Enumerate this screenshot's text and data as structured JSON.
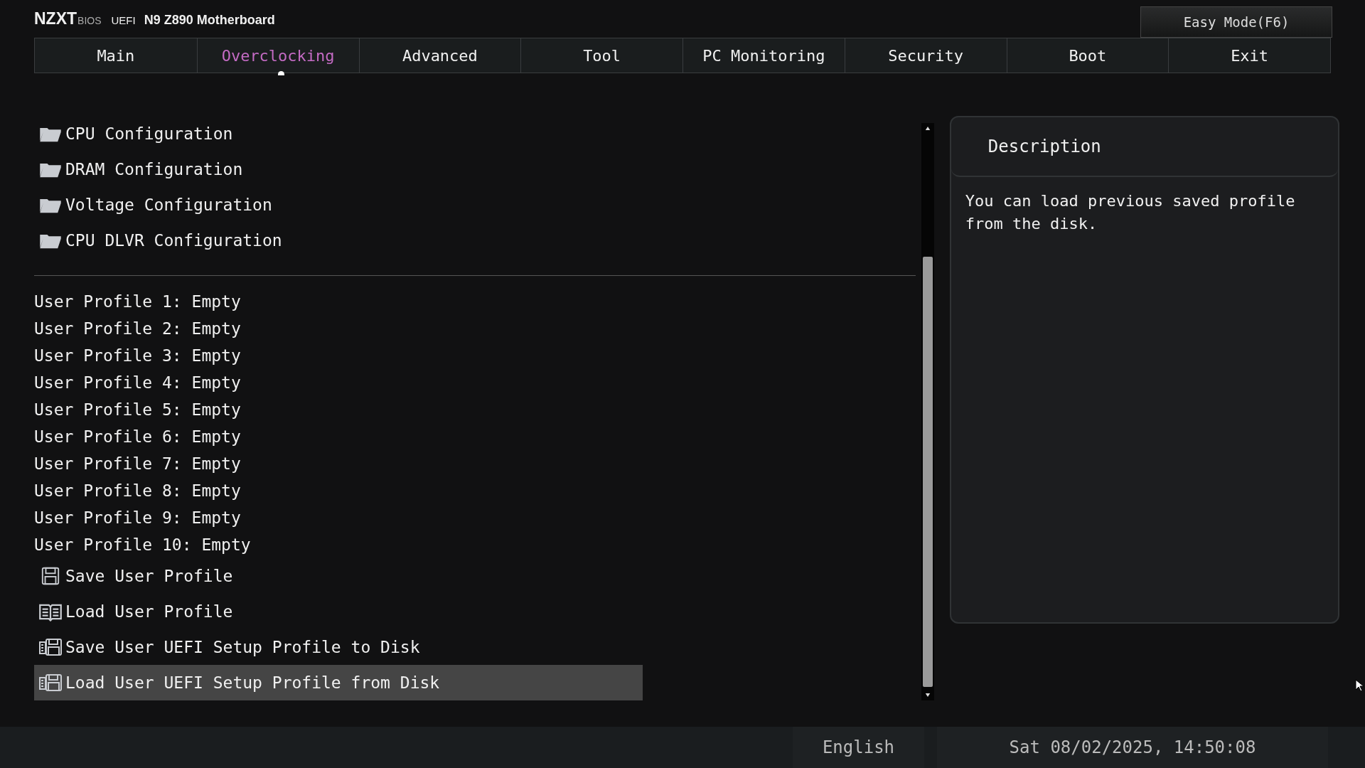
{
  "header": {
    "brand": "NZXT",
    "bios": "BIOS",
    "uefi": "UEFI",
    "model": "N9 Z890 Motherboard",
    "easy_mode_button": "Easy Mode(F6)"
  },
  "tabs": [
    {
      "label": "Main",
      "selected": false
    },
    {
      "label": "Overclocking",
      "selected": true
    },
    {
      "label": "Advanced",
      "selected": false
    },
    {
      "label": "Tool",
      "selected": false
    },
    {
      "label": "PC Monitoring",
      "selected": false
    },
    {
      "label": "Security",
      "selected": false
    },
    {
      "label": "Boot",
      "selected": false
    },
    {
      "label": "Exit",
      "selected": false
    }
  ],
  "submenus": [
    {
      "label": "CPU Configuration",
      "kind": "folder",
      "selected": false
    },
    {
      "label": "DRAM Configuration",
      "kind": "folder",
      "selected": false
    },
    {
      "label": "Voltage Configuration",
      "kind": "folder",
      "selected": false
    },
    {
      "label": "CPU DLVR Configuration",
      "kind": "folder",
      "selected": false
    }
  ],
  "items": [
    {
      "label": "User Profile 1: Empty",
      "kind": "text",
      "selected": false
    },
    {
      "label": "User Profile 2: Empty",
      "kind": "text",
      "selected": false
    },
    {
      "label": "User Profile 3: Empty",
      "kind": "text",
      "selected": false
    },
    {
      "label": "User Profile 4: Empty",
      "kind": "text",
      "selected": false
    },
    {
      "label": "User Profile 5: Empty",
      "kind": "text",
      "selected": false
    },
    {
      "label": "User Profile 6: Empty",
      "kind": "text",
      "selected": false
    },
    {
      "label": "User Profile 7: Empty",
      "kind": "text",
      "selected": false
    },
    {
      "label": "User Profile 8: Empty",
      "kind": "text",
      "selected": false
    },
    {
      "label": "User Profile 9: Empty",
      "kind": "text",
      "selected": false
    },
    {
      "label": "User Profile 10: Empty",
      "kind": "text",
      "selected": false
    },
    {
      "label": "Save User Profile",
      "kind": "save",
      "selected": false
    },
    {
      "label": "Load User Profile",
      "kind": "book",
      "selected": false
    },
    {
      "label": "Save User UEFI Setup Profile to Disk",
      "kind": "disk",
      "selected": false
    },
    {
      "label": "Load User UEFI Setup Profile from Disk",
      "kind": "disk",
      "selected": true
    }
  ],
  "description": {
    "title": "Description",
    "text": "You can load previous saved profile from the disk."
  },
  "status_bar": {
    "language": "English",
    "datetime": "Sat 08/02/2025, 14:50:08"
  }
}
